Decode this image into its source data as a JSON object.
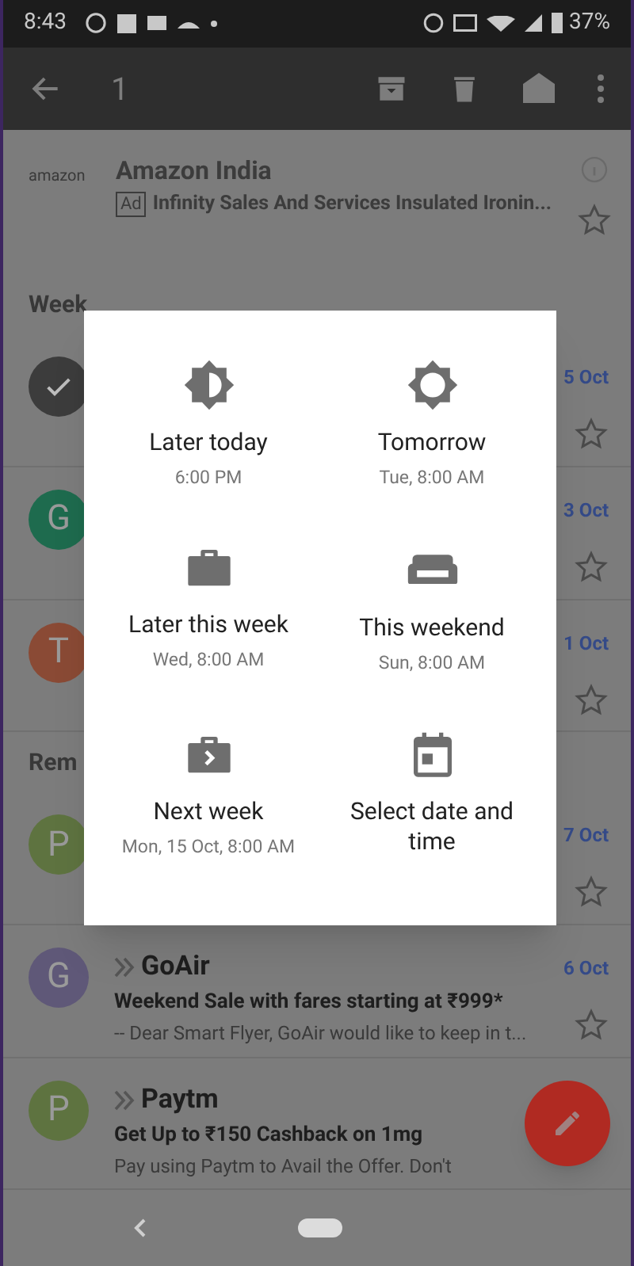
{
  "status_bar": {
    "time": "8:43",
    "battery": "37%"
  },
  "toolbar": {
    "selected_count": "1"
  },
  "ad": {
    "logo": "amazon",
    "sender": "Amazon India",
    "badge": "Ad",
    "subject": "Infinity Sales And Services Insulated Ironin..."
  },
  "list": [
    {
      "kind": "section",
      "title": "Week"
    },
    {
      "kind": "email",
      "color": "#3c3c3c",
      "date": "5 Oct"
    },
    {
      "kind": "email",
      "avatar": "G",
      "color": "#1e6b4e",
      "date": "3 Oct"
    },
    {
      "kind": "email",
      "avatar": "T",
      "color": "#8a4a35",
      "date": "1 Oct"
    },
    {
      "kind": "section",
      "title": "Rem"
    },
    {
      "kind": "email",
      "avatar": "P",
      "color": "#5e7340",
      "date": "7 Oct"
    },
    {
      "kind": "email",
      "avatar": "G",
      "color": "#5f5878",
      "date": "6 Oct",
      "sender": "GoAir",
      "subject": "Weekend Sale with fares starting at ₹999*",
      "snippet": "-- Dear Smart Flyer, GoAir would like to keep in t..."
    },
    {
      "kind": "email",
      "avatar": "P",
      "color": "#5e7340",
      "sender": "Paytm",
      "subject": "Get Up to ₹150 Cashback on 1mg",
      "snippet": "Pay using Paytm to Avail the Offer. Don't"
    }
  ],
  "snooze_dialog": {
    "options": [
      {
        "kind": "half_sun",
        "label": "Later today",
        "time": "6:00 PM"
      },
      {
        "kind": "sun",
        "label": "Tomorrow",
        "time": "Tue, 8:00 AM"
      },
      {
        "kind": "briefcase",
        "label": "Later this week",
        "time": "Wed, 8:00 AM"
      },
      {
        "kind": "couch",
        "label": "This weekend",
        "time": "Sun, 8:00 AM"
      },
      {
        "kind": "briefcase_arrow",
        "label": "Next week",
        "time": "Mon, 15 Oct, 8:00 AM"
      },
      {
        "kind": "calendar",
        "label": "Select date and time"
      }
    ]
  }
}
